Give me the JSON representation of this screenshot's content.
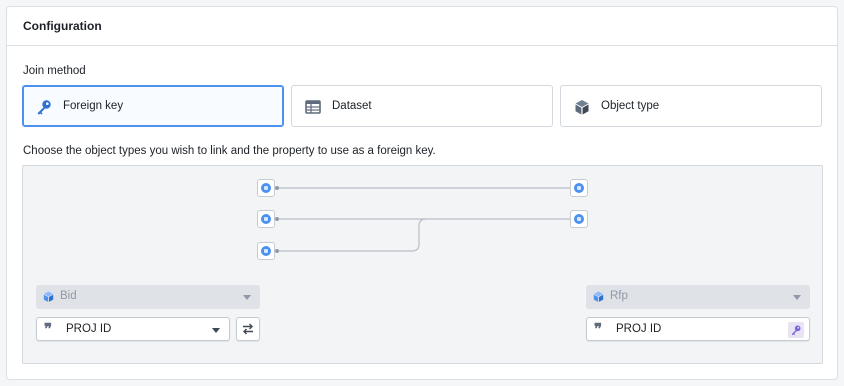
{
  "header": {
    "title": "Configuration"
  },
  "join_method": {
    "label": "Join method",
    "options": [
      {
        "label": "Foreign key",
        "icon": "key-icon",
        "selected": true
      },
      {
        "label": "Dataset",
        "icon": "table-icon",
        "selected": false
      },
      {
        "label": "Object type",
        "icon": "cube-icon",
        "selected": false
      }
    ]
  },
  "description": "Choose the object types you wish to link and the property to use as a foreign key.",
  "left": {
    "object_type": "Bid",
    "property": "PROJ ID"
  },
  "right": {
    "object_type": "Rfp",
    "property": "PROJ ID"
  },
  "colors": {
    "accent": "#4c90f0",
    "key_icon": "#2d72d2",
    "foreign_key_badge": "#7961db"
  }
}
